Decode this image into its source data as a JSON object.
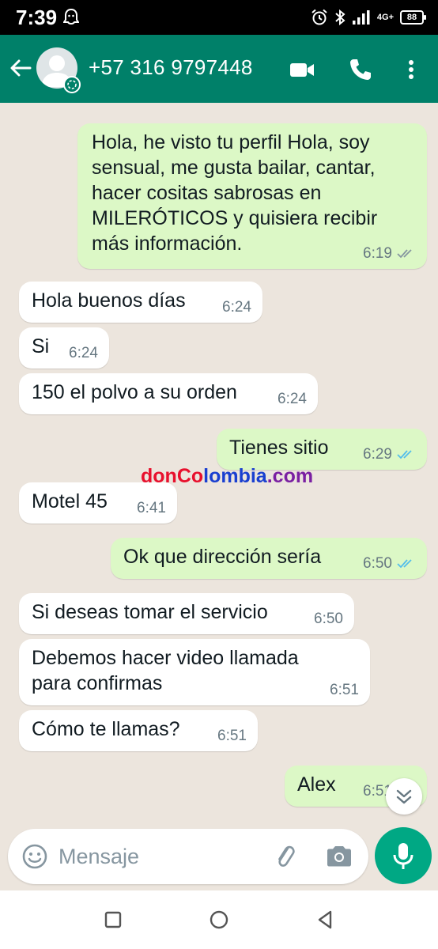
{
  "status_bar": {
    "time": "7:39",
    "network": "4G+",
    "battery": "88"
  },
  "header": {
    "contact_name": "+57 316 9797448",
    "icons": [
      "back-arrow-icon",
      "avatar-icon",
      "video-call-icon",
      "phone-icon",
      "more-options-icon"
    ]
  },
  "messages": [
    {
      "dir": "out",
      "text": "Hola, he visto tu perfil Hola, soy sensual, me gusta bailar, cantar, hacer cositas sabrosas en MILERÓTICOS y quisiera recibir más información.",
      "lines": [
        "Hola, he visto tu perfil Hola, soy",
        "sensual, me gusta bailar, cantar,",
        "hacer cositas sabrosas en",
        "MILERÓTICOS y quisiera recibir",
        "más información."
      ],
      "time": "6:19",
      "status": "delivered"
    },
    {
      "dir": "in",
      "text": "Hola buenos días",
      "time": "6:24"
    },
    {
      "dir": "in",
      "text": "Si",
      "time": "6:24"
    },
    {
      "dir": "in",
      "text": "150 el polvo a su orden",
      "time": "6:24"
    },
    {
      "dir": "out",
      "text": "Tienes sitio",
      "time": "6:29",
      "status": "read"
    },
    {
      "dir": "in",
      "text": "Motel 45",
      "time": "6:41"
    },
    {
      "dir": "out",
      "text": "Ok que dirección sería",
      "time": "6:50",
      "status": "read"
    },
    {
      "dir": "in",
      "text": "Si deseas tomar el servicio",
      "time": "6:50"
    },
    {
      "dir": "in",
      "text": "Debemos hacer video llamada para confirmas",
      "lines": [
        "Debemos hacer video llamada",
        "para confirmas"
      ],
      "time": "6:51"
    },
    {
      "dir": "in",
      "text": "Cómo te llamas?",
      "time": "6:51"
    },
    {
      "dir": "out",
      "text": "Alex",
      "time": "6:51",
      "status": "read"
    }
  ],
  "watermark": {
    "part1": "donCo",
    "part2": "lombia",
    "part3": ".com"
  },
  "composer": {
    "placeholder": "Mensaje"
  },
  "colors": {
    "header": "#008069",
    "outgoing": "#dcf8c6",
    "incoming": "#ffffff",
    "read_tick": "#53bdeb",
    "accent": "#00a884",
    "watermark_red": "#e8102d",
    "watermark_blue": "#1a3fd0",
    "watermark_purple": "#7a1fa2"
  }
}
